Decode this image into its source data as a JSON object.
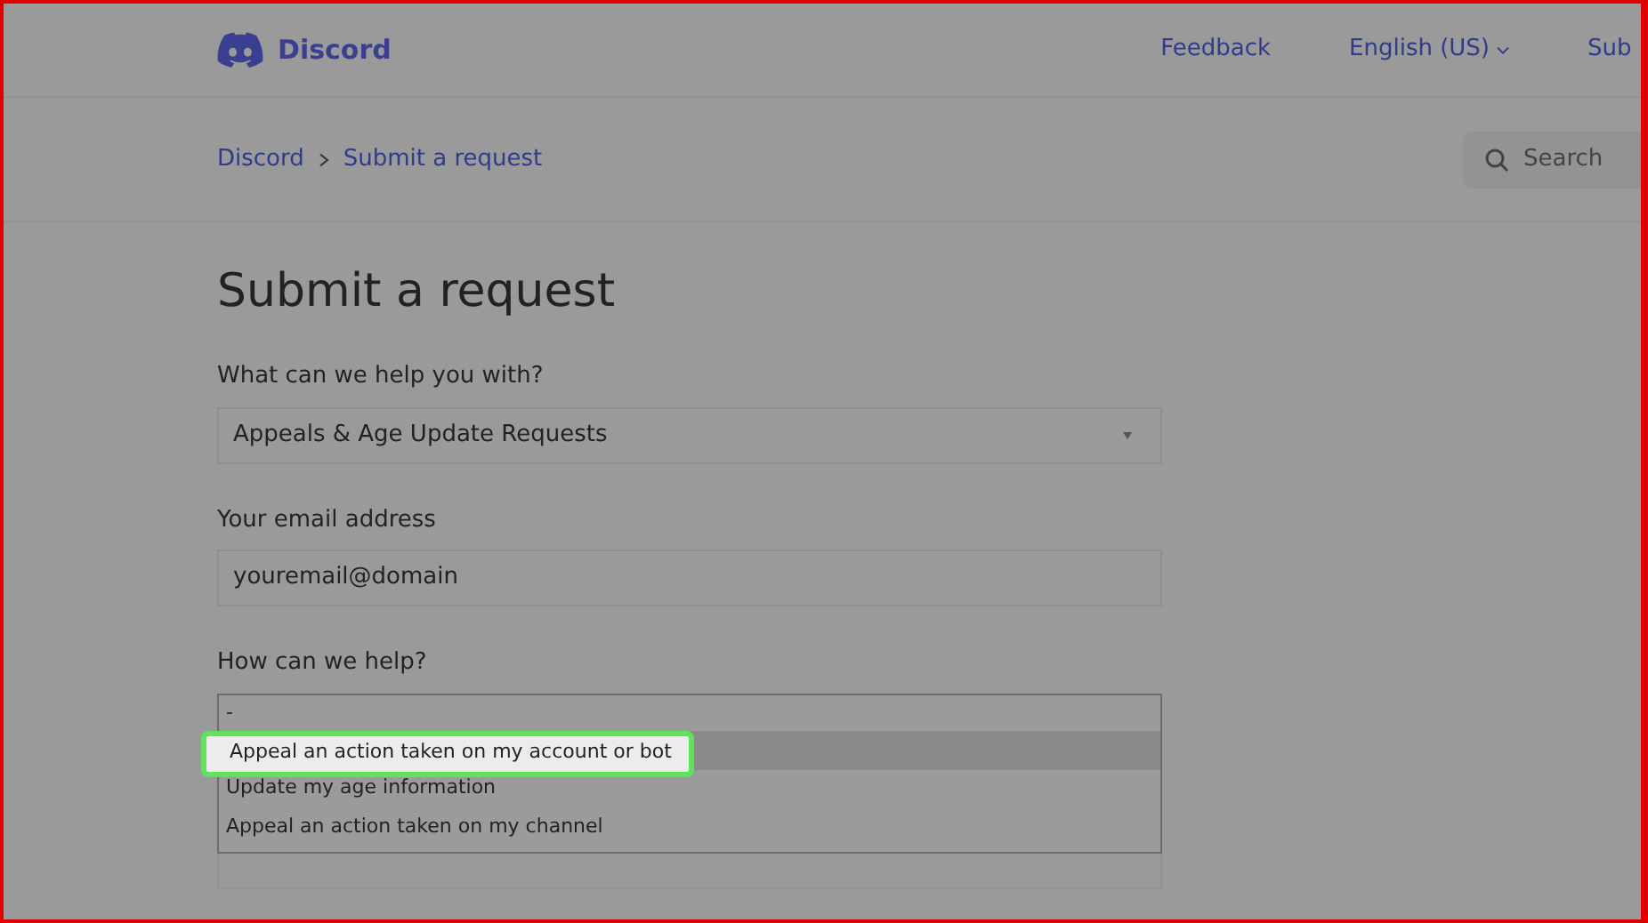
{
  "header": {
    "logo": "Discord",
    "nav": [
      "Feedback",
      "English (US)",
      "Sub"
    ]
  },
  "breadcrumb": [
    "Discord",
    "Submit a request"
  ],
  "search": {
    "placeholder": "Search"
  },
  "title": "Submit a request",
  "fields": [
    {
      "kind": "select",
      "label": "What can we help you with?",
      "value": "Appeals & Age Update Requests"
    },
    {
      "kind": "input",
      "label": "Your email address",
      "value": "youremail@domain"
    },
    {
      "kind": "list",
      "label": "How can we help?",
      "value": "-",
      "options": [
        {
          "label": "Appeal an action taken on my account or bot",
          "selected": true
        },
        {
          "label": "Update my age information",
          "selected": false
        },
        {
          "label": "Appeal an action taken on my channel",
          "selected": false
        }
      ]
    }
  ]
}
